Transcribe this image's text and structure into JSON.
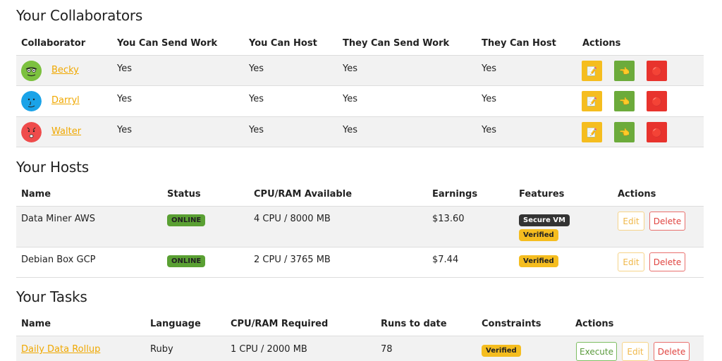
{
  "collaborators": {
    "title": "Your Collaborators",
    "headers": {
      "collaborator": "Collaborator",
      "you_send": "You Can Send Work",
      "you_host": "You Can Host",
      "they_send": "They Can Send Work",
      "they_host": "They Can Host",
      "actions": "Actions"
    },
    "rows": [
      {
        "name": "Becky",
        "you_send": "Yes",
        "you_host": "Yes",
        "they_send": "Yes",
        "they_host": "Yes",
        "avatar_color": "#7cc13f"
      },
      {
        "name": "Darryl",
        "you_send": "Yes",
        "you_host": "Yes",
        "they_send": "Yes",
        "they_host": "Yes",
        "avatar_color": "#1aa3e8"
      },
      {
        "name": "Walter",
        "you_send": "Yes",
        "you_host": "Yes",
        "they_send": "Yes",
        "they_host": "Yes",
        "avatar_color": "#ef4b4b"
      }
    ],
    "action_icons": [
      "edit-note-icon",
      "point-hand-icon",
      "red-circle-icon"
    ]
  },
  "hosts": {
    "title": "Your Hosts",
    "headers": {
      "name": "Name",
      "status": "Status",
      "cpu_ram": "CPU/RAM Available",
      "earnings": "Earnings",
      "features": "Features",
      "actions": "Actions"
    },
    "rows": [
      {
        "name": "Data Miner AWS",
        "status": "ONLINE",
        "cpu_ram": "4 CPU / 8000 MB",
        "earnings": "$13.60",
        "features": [
          "Secure VM",
          "Verified"
        ],
        "edit": "Edit",
        "delete": "Delete"
      },
      {
        "name": "Debian Box GCP",
        "status": "ONLINE",
        "cpu_ram": "2 CPU / 3765 MB",
        "earnings": "$7.44",
        "features": [
          "Verified"
        ],
        "edit": "Edit",
        "delete": "Delete"
      }
    ]
  },
  "tasks": {
    "title": "Your Tasks",
    "headers": {
      "name": "Name",
      "language": "Language",
      "cpu_ram": "CPU/RAM Required",
      "runs": "Runs to date",
      "constraints": "Constraints",
      "actions": "Actions"
    },
    "rows": [
      {
        "name": "Daily Data Rollup",
        "language": "Ruby",
        "cpu_ram": "1 CPU / 2000 MB",
        "runs": "78",
        "constraints": "Verified",
        "execute": "Execute",
        "edit": "Edit",
        "delete": "Delete"
      }
    ]
  },
  "colors": {
    "link": "#f0a800",
    "online": "#5aa033",
    "verified": "#f5bd1f",
    "secure_vm": "#333333",
    "action_yellow": "#f5bd1f",
    "action_green": "#6cab3b",
    "action_red": "#e8332d"
  }
}
